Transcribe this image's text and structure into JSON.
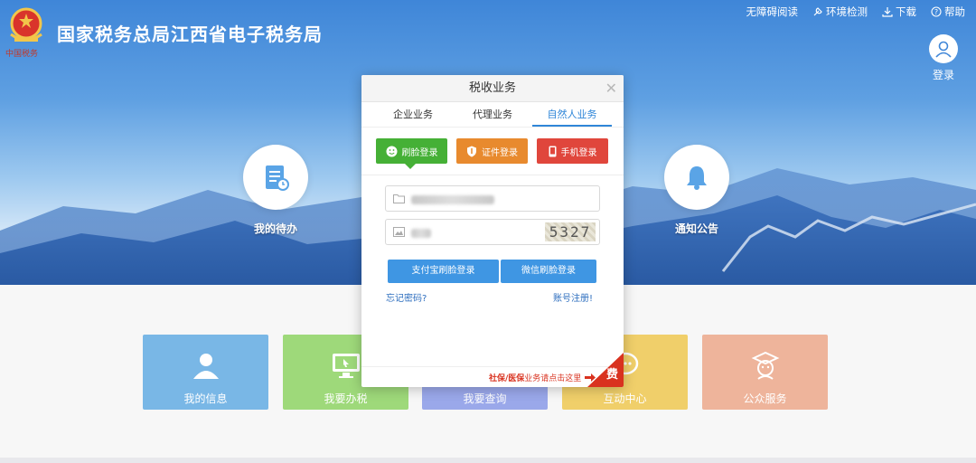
{
  "header": {
    "site_title": "国家税务总局江西省电子税务局",
    "logo_text": "中国税务",
    "links": [
      {
        "label": "无障碍阅读",
        "icon": ""
      },
      {
        "label": "环境检测",
        "icon": "wrench-icon"
      },
      {
        "label": "下载",
        "icon": "download-icon"
      },
      {
        "label": "帮助",
        "icon": "help-icon"
      }
    ],
    "login_label": "登录"
  },
  "hero": {
    "todo_label": "我的待办",
    "notice_label": "通知公告"
  },
  "tiles": [
    {
      "label": "我的信息",
      "color": "#79b7e6",
      "icon": "user-icon"
    },
    {
      "label": "我要办税",
      "color": "#9ed97a",
      "icon": "monitor-icon"
    },
    {
      "label": "我要查询",
      "color": "#9aa8ea",
      "icon": "search-icon"
    },
    {
      "label": "互动中心",
      "color": "#f0cf6a",
      "icon": "chat-icon"
    },
    {
      "label": "公众服务",
      "color": "#eeb49b",
      "icon": "graduate-icon"
    }
  ],
  "dialog": {
    "title": "税收业务",
    "tabs": [
      {
        "label": "企业业务",
        "active": false
      },
      {
        "label": "代理业务",
        "active": false
      },
      {
        "label": "自然人业务",
        "active": true
      }
    ],
    "login_modes": [
      {
        "label": "刷脸登录",
        "color": "#45b036"
      },
      {
        "label": "证件登录",
        "color": "#e88a2e"
      },
      {
        "label": "手机登录",
        "color": "#e0463c"
      }
    ],
    "captcha_text": "5327",
    "buttons": {
      "alipay_face": "支付宝刷脸登录",
      "wechat_face": "微信刷脸登录"
    },
    "links": {
      "forgot_password": "忘记密码?",
      "register": "账号注册!"
    },
    "shebao": {
      "highlight": "社保/医保",
      "rest": "业务请点击这里"
    },
    "corner_text": "费"
  }
}
